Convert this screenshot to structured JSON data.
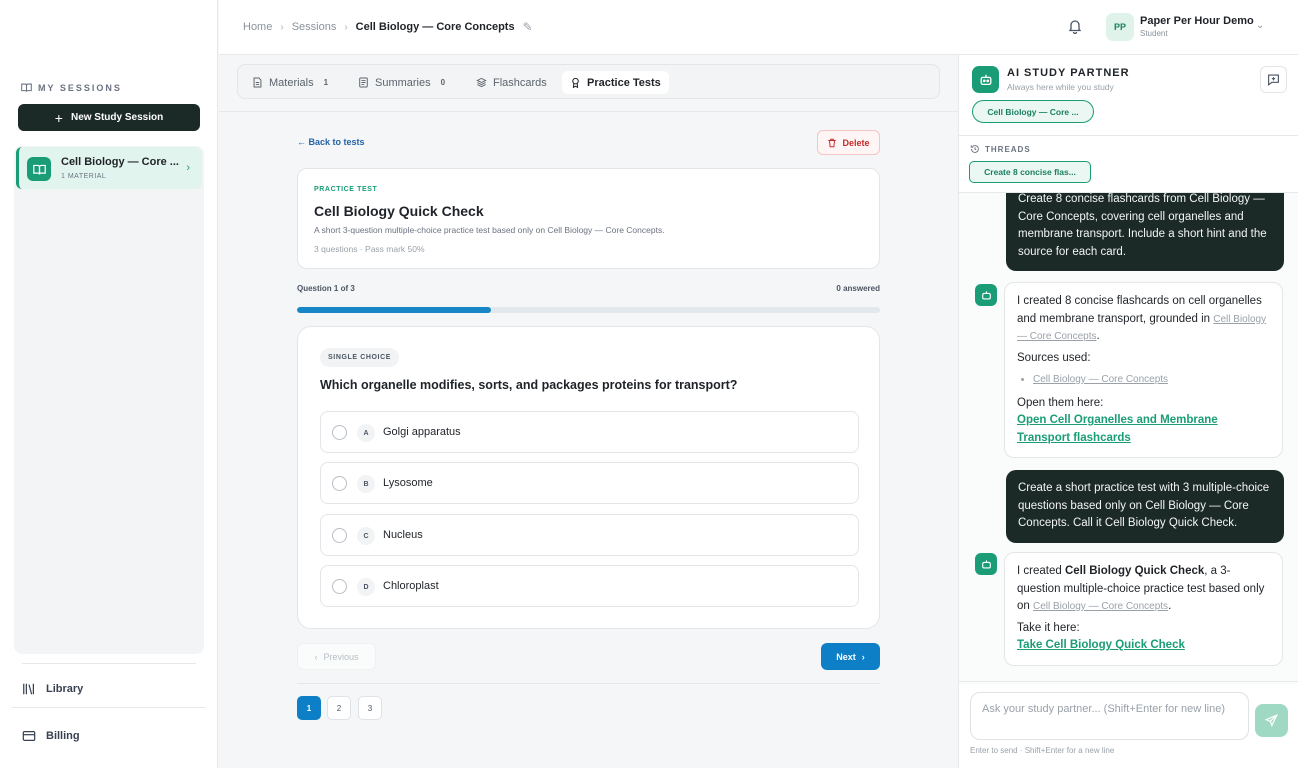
{
  "sidebar": {
    "section_label": "MY SESSIONS",
    "new_session_label": "New Study Session",
    "sessions": [
      {
        "title": "Cell Biology — Core ...",
        "subtitle": "1 MATERIAL"
      }
    ],
    "links": [
      {
        "label": "Library",
        "icon": "library-icon"
      },
      {
        "label": "Billing",
        "icon": "credit-card-icon"
      }
    ]
  },
  "header": {
    "breadcrumb": [
      "Home",
      "Sessions",
      "Cell Biology — Core Concepts"
    ],
    "user_initials": "PP",
    "user_name": "Paper Per Hour Demo",
    "user_role": "Student"
  },
  "tabs": [
    {
      "label": "Materials",
      "count": "1",
      "icon": "file-icon"
    },
    {
      "label": "Summaries",
      "count": "0",
      "icon": "document-icon"
    },
    {
      "label": "Flashcards",
      "count": "",
      "icon": "layers-icon"
    },
    {
      "label": "Practice Tests",
      "count": "",
      "icon": "award-icon"
    }
  ],
  "test": {
    "back_label": "← Back to tests",
    "delete_label": "Delete",
    "eyebrow": "PRACTICE TEST",
    "title": "Cell Biology Quick Check",
    "description": "A short 3-question multiple-choice practice test based only on Cell Biology — Core Concepts.",
    "meta": "3 questions · Pass mark 50%",
    "progress_label": "Question 1 of 3",
    "answered_label": "0 answered",
    "progress_fraction": 0.333
  },
  "question": {
    "type_label": "SINGLE CHOICE",
    "text": "Which organelle modifies, sorts, and packages proteins for transport?",
    "options": [
      {
        "letter": "A",
        "text": "Golgi apparatus"
      },
      {
        "letter": "B",
        "text": "Lysosome"
      },
      {
        "letter": "C",
        "text": "Nucleus"
      },
      {
        "letter": "D",
        "text": "Chloroplast"
      }
    ]
  },
  "navigation": {
    "previous_label": "Previous",
    "next_label": "Next",
    "pages": [
      "1",
      "2",
      "3"
    ],
    "current_page": "1"
  },
  "chat": {
    "title": "AI STUDY PARTNER",
    "subtitle": "Always here while you study",
    "context_chip": "Cell Biology — Core ...",
    "threads_label": "THREADS",
    "thread_chip": "Create 8 concise flas...",
    "messages": {
      "user1": "Create 8 concise flashcards from Cell Biology — Core Concepts, covering cell organelles and membrane transport. Include a short hint and the source for each card.",
      "bot1_pre": "I created 8 concise flashcards on cell organelles and membrane transport, grounded in ",
      "bot1_src": "Cell Biology — Core Concepts",
      "bot1_post": ".",
      "bot1_sources_label": "Sources used:",
      "bot1_source_item": "Cell Biology — Core Concepts",
      "bot1_open_label": "Open them here:",
      "bot1_link": "Open Cell Organelles and Membrane Transport flashcards",
      "user2": "Create a short practice test with 3 multiple-choice questions based only on Cell Biology — Core Concepts. Call it Cell Biology Quick Check.",
      "bot2_pre": "I created ",
      "bot2_bold": "Cell Biology Quick Check",
      "bot2_mid": ", a 3-question multiple-choice practice test based only on ",
      "bot2_src": "Cell Biology — Core Concepts",
      "bot2_post": ".",
      "bot2_take_label": "Take it here:",
      "bot2_link": "Take Cell Biology Quick Check"
    },
    "input_placeholder": "Ask your study partner... (Shift+Enter for new line)",
    "hint": "Enter to send · Shift+Enter for a new line"
  },
  "colors": {
    "accent": "#1a9d76",
    "primary_blue": "#0d7fc7",
    "dark": "#1b2a27",
    "danger": "#c42b2b"
  }
}
